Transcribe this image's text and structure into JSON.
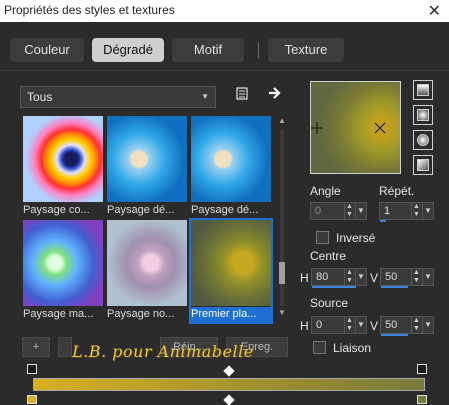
{
  "window": {
    "title": "Propriétés des styles et textures",
    "close_glyph": "✕"
  },
  "tabs": [
    {
      "label": "Couleur"
    },
    {
      "label": "Dégradé"
    },
    {
      "label": "Motif"
    },
    {
      "label": "Texture"
    }
  ],
  "filter": {
    "selected": "Tous"
  },
  "presets": [
    {
      "caption": "Paysage co..."
    },
    {
      "caption": "Paysage dé..."
    },
    {
      "caption": "Paysage dé..."
    },
    {
      "caption": "Paysage ma..."
    },
    {
      "caption": "Paysage no..."
    },
    {
      "caption": "Premier pla..."
    }
  ],
  "controls": {
    "angle_label": "Angle",
    "angle_value": "0",
    "repeat_label": "Répét.",
    "repeat_value": "1",
    "invert_label": "Inversé",
    "centre_label": "Centre",
    "centre_h_label": "H",
    "centre_h_value": "80",
    "centre_v_label": "V",
    "centre_v_value": "50",
    "source_label": "Source",
    "source_h_label": "H",
    "source_h_value": "0",
    "source_v_label": "V",
    "source_v_value": "50",
    "link_label": "Liaison"
  },
  "bottom": {
    "add_label": "+",
    "reset_label": "Réin...",
    "save_label": "Enreg.",
    "watermark": "L.B. pour Animabelle"
  },
  "colors": {
    "accent": "#1e6fd1",
    "gradient_start": "#d8b021",
    "gradient_end": "#777a3a"
  }
}
